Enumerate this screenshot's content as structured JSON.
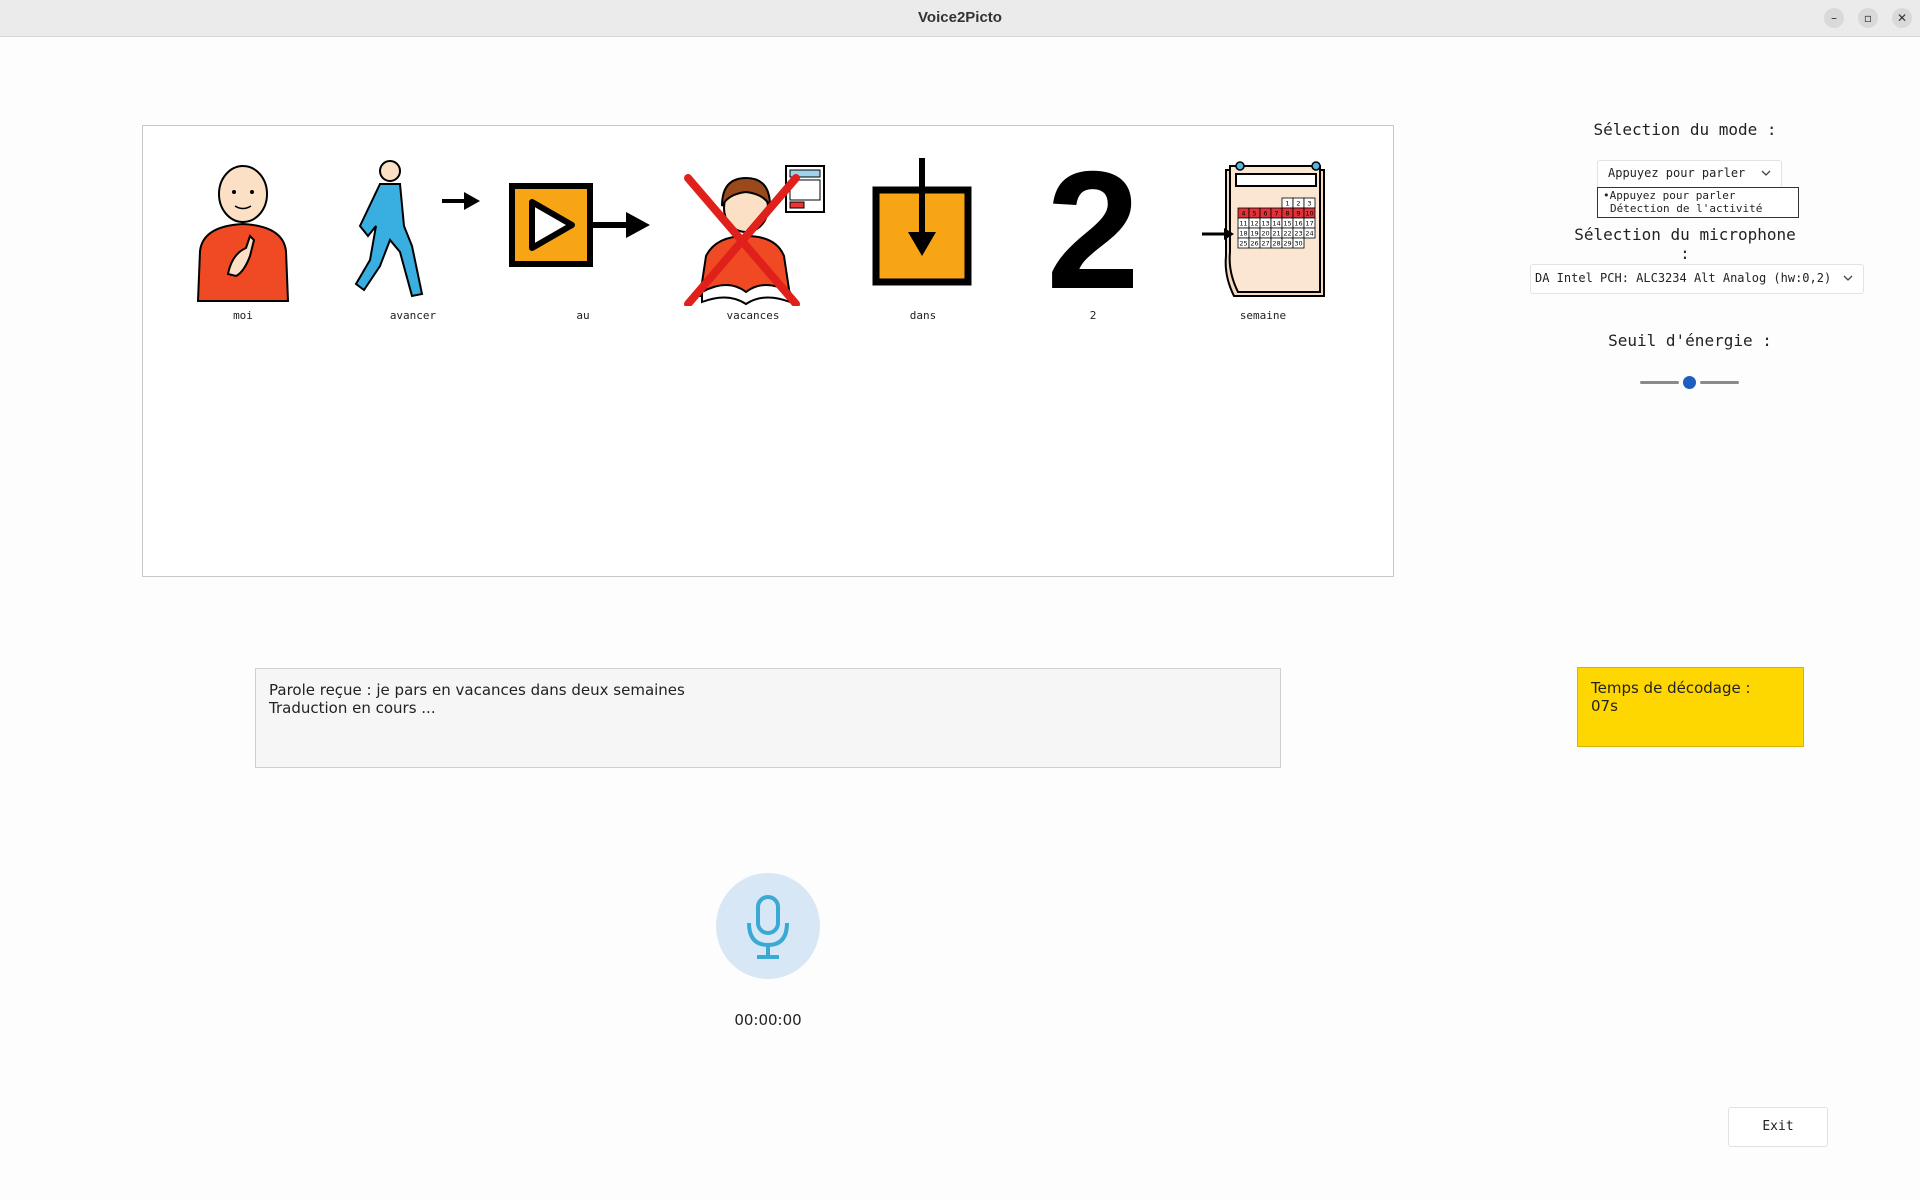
{
  "window": {
    "title": "Voice2Picto",
    "controls": [
      "–",
      "▫",
      "✕"
    ]
  },
  "pictograms": [
    {
      "label": "moi",
      "icon": "person-pointing-self-icon"
    },
    {
      "label": "avancer",
      "icon": "walking-person-arrow-icon"
    },
    {
      "label": "au",
      "icon": "play-box-arrow-icon"
    },
    {
      "label": "vacances",
      "icon": "crossed-out-studying-child-icon"
    },
    {
      "label": "dans",
      "icon": "arrow-into-box-icon"
    },
    {
      "label": "2",
      "icon": "number-two-icon"
    },
    {
      "label": "semaine",
      "icon": "calendar-week-icon"
    }
  ],
  "calendar_numbers": [
    "1",
    "2",
    "3",
    "4",
    "5",
    "6",
    "7",
    "8",
    "9",
    "10",
    "11",
    "12",
    "13",
    "14",
    "15",
    "16",
    "17",
    "18",
    "19",
    "20",
    "21",
    "22",
    "23",
    "24",
    "25",
    "26",
    "27",
    "28",
    "29",
    "30"
  ],
  "settings": {
    "mode_label": "Sélection du mode :",
    "mode_selected": "Appuyez pour parler",
    "mode_options": [
      "Appuyez pour parler",
      "Détection de l'activité"
    ],
    "mode_popup_bullet": "•",
    "microphone_label": "Sélection du microphone :",
    "microphone_selected": "DA Intel PCH: ALC3234 Alt Analog (hw:0,2)",
    "energy_label": "Seuil d'énergie :",
    "energy_level": 0.5
  },
  "speech": {
    "line1": "Parole reçue : je pars en vacances dans deux semaines",
    "line2": "Traduction en cours ..."
  },
  "decoding": {
    "line1": "Temps de décodage :",
    "line2": "07s"
  },
  "recorder": {
    "timer": "00:00:00"
  },
  "exit_label": "Exit",
  "colors": {
    "accent": "#1c5fbf",
    "decode_bg": "#ffd700",
    "mic_bg": "#d8e7f5",
    "mic_icon": "#3aa9d4"
  }
}
